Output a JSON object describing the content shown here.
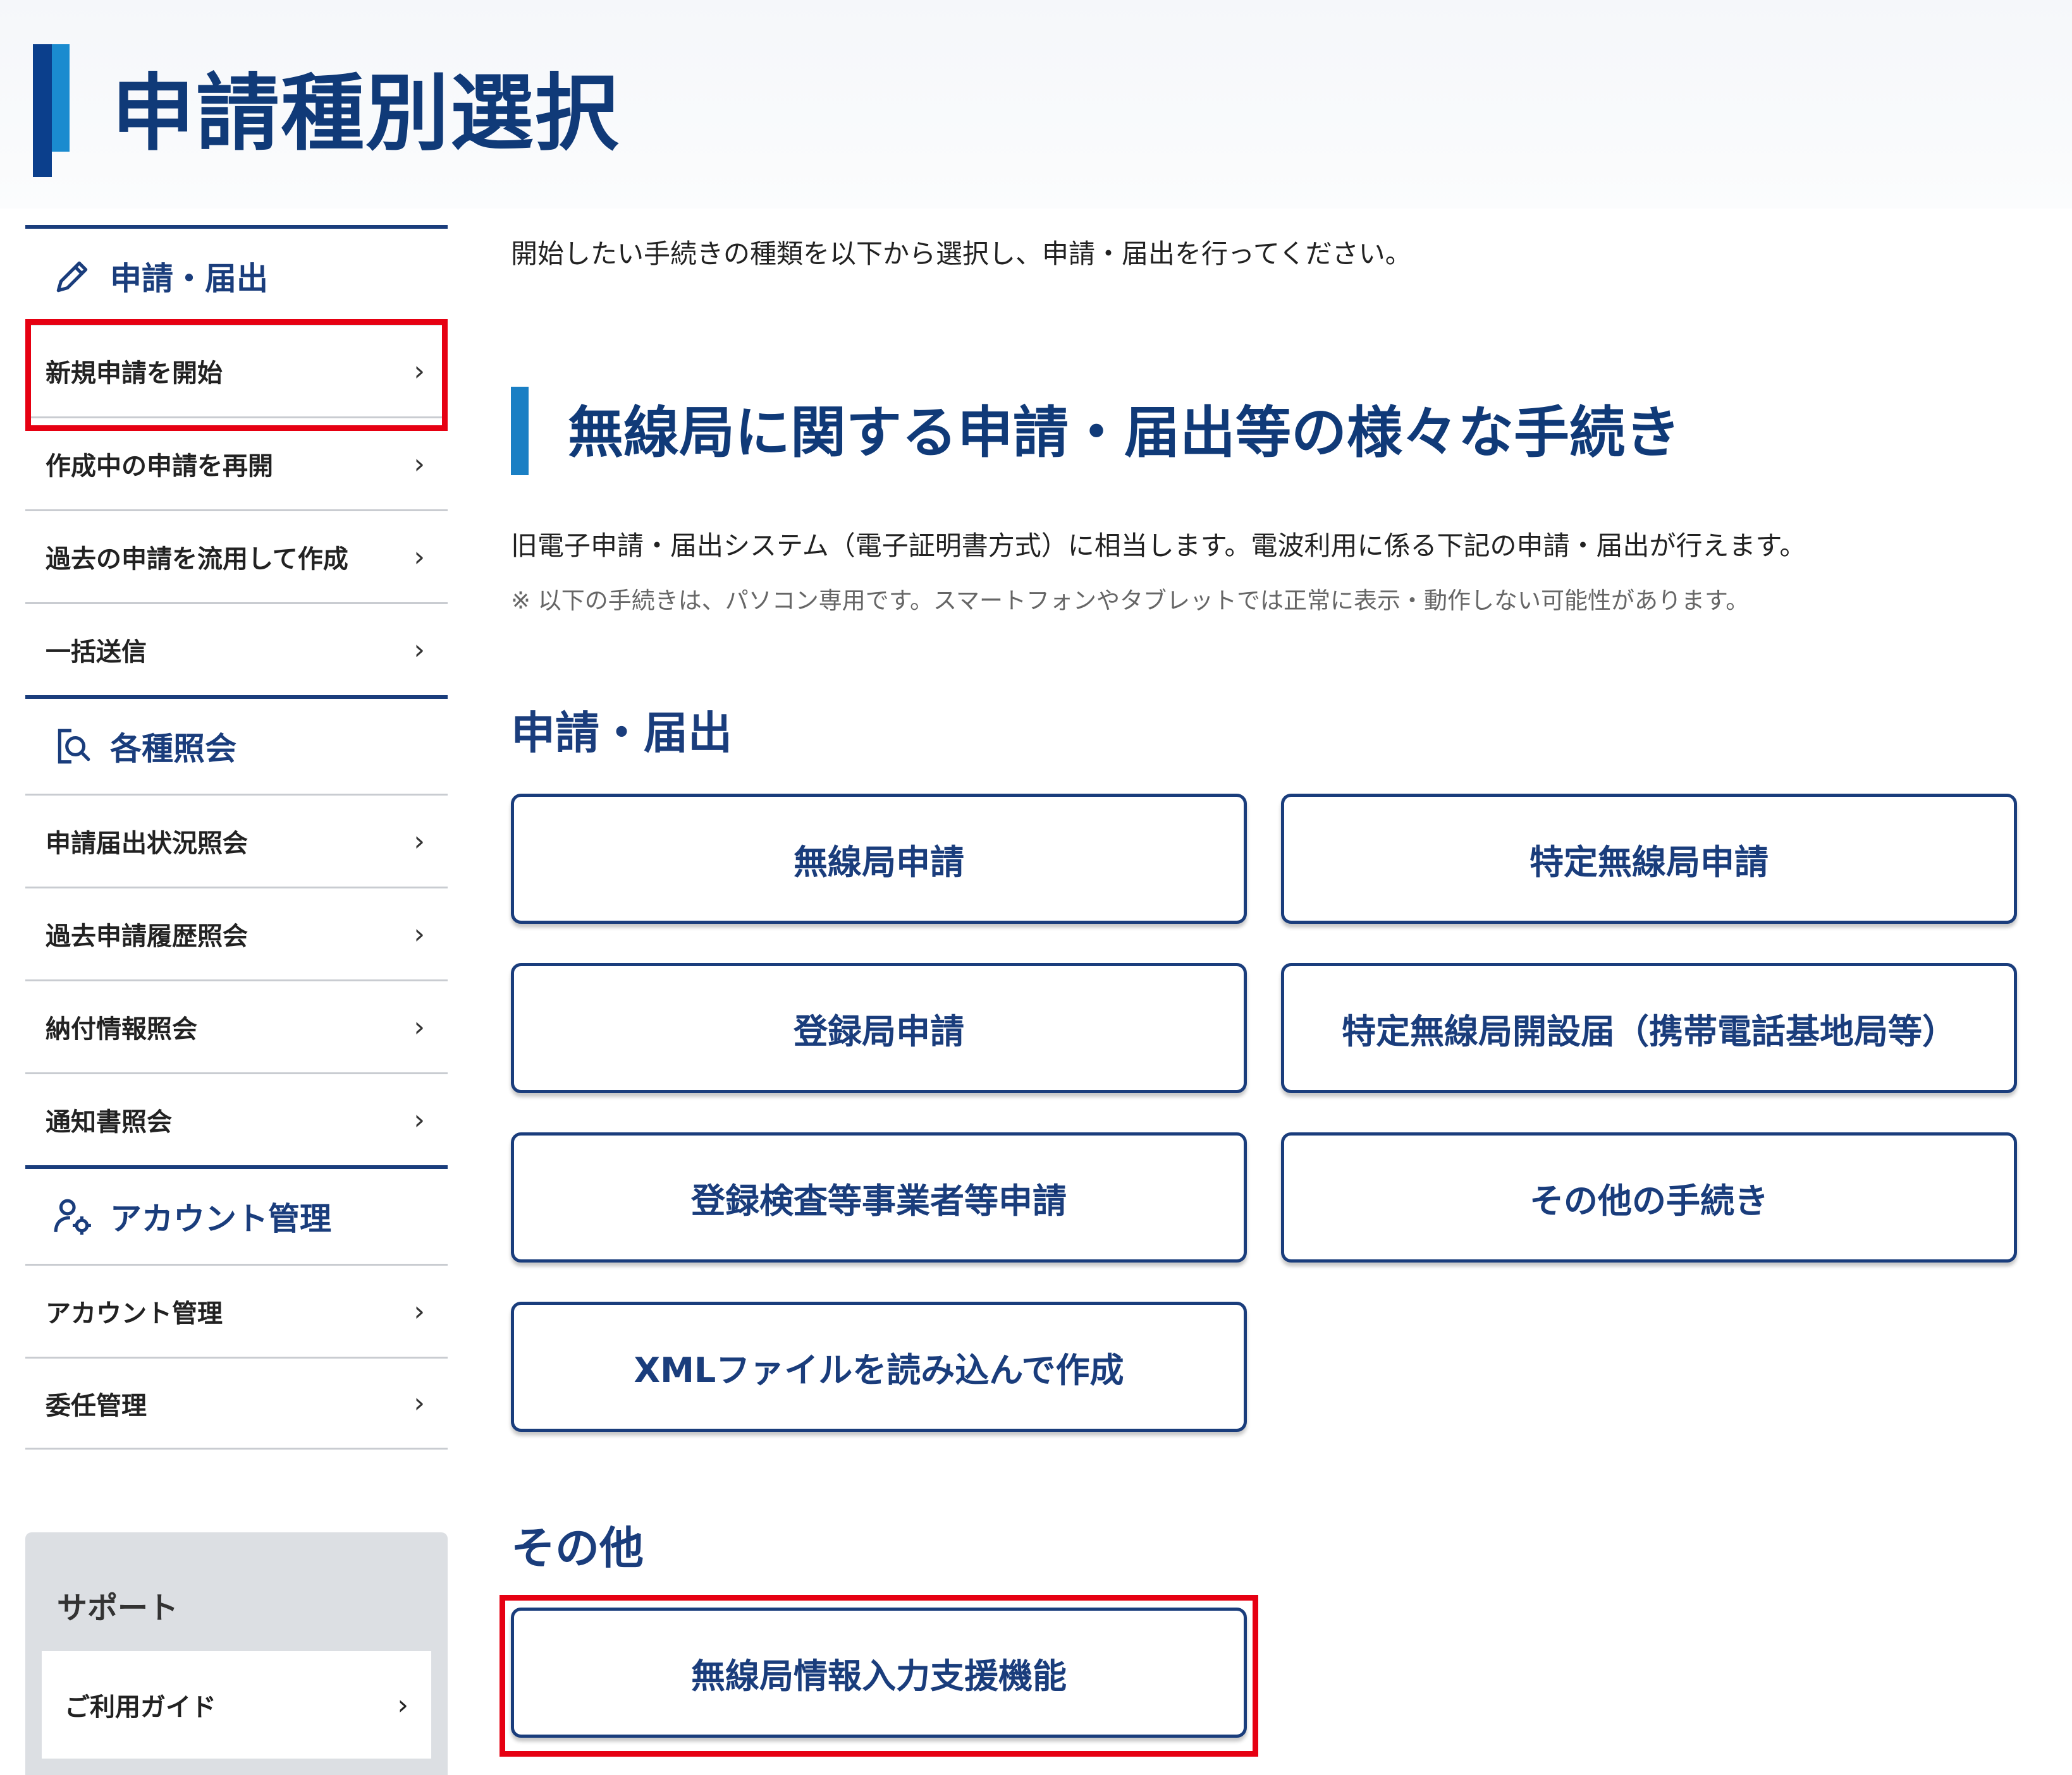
{
  "page": {
    "title": "申請種別選択",
    "accent_color": "#103a78",
    "highlight_color": "#e60012"
  },
  "sidebar": {
    "sections": [
      {
        "title": "申請・届出",
        "icon": "pencil-icon",
        "items": [
          "新規申請を開始",
          "作成中の申請を再開",
          "過去の申請を流用して作成",
          "一括送信"
        ]
      },
      {
        "title": "各種照会",
        "icon": "document-search-icon",
        "items": [
          "申請届出状況照会",
          "過去申請履歴照会",
          "納付情報照会",
          "通知書照会"
        ]
      },
      {
        "title": "アカウント管理",
        "icon": "user-gear-icon",
        "items": [
          "アカウント管理",
          "委任管理"
        ]
      }
    ],
    "support": {
      "title": "サポート",
      "items": [
        "ご利用ガイド"
      ]
    },
    "chevron": "›"
  },
  "main": {
    "intro": "開始したい手続きの種類を以下から選択し、申請・届出を行ってください。",
    "section_title": "無線局に関する申請・届出等の様々な手続き",
    "description": "旧電子申請・届出システム（電子証明書方式）に相当します。電波利用に係る下記の申請・届出が行えます。",
    "note": "※ 以下の手続きは、パソコン専用です。スマートフォンやタブレットでは正常に表示・動作しない可能性があります。",
    "groups": [
      {
        "title": "申請・届出",
        "buttons": [
          "無線局申請",
          "特定無線局申請",
          "登録局申請",
          "特定無線局開設届（携帯電話基地局等）",
          "登録検査等事業者等申請",
          "その他の手続き",
          "XMLファイルを読み込んで作成"
        ]
      },
      {
        "title": "その他",
        "buttons": [
          "無線局情報入力支援機能"
        ]
      }
    ]
  }
}
